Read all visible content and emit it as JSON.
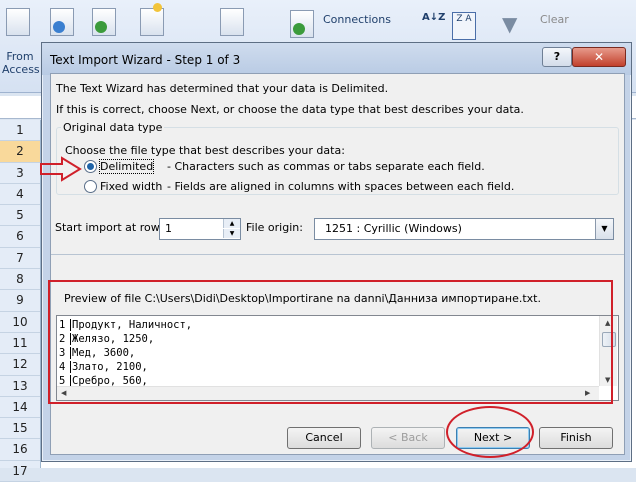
{
  "ribbon": {
    "from_access_line1": "From",
    "from_access_line2": "Access",
    "connections_label": "Connections",
    "clear_label": "Clear",
    "row_headers": [
      "1",
      "2",
      "3",
      "4",
      "5",
      "6",
      "7",
      "8",
      "9",
      "10",
      "11",
      "12",
      "13",
      "14",
      "15",
      "16",
      "17"
    ]
  },
  "dialog": {
    "title": "Text Import Wizard - Step 1 of 3",
    "help_label": "?",
    "close_label": "✕",
    "intro_line1": "The Text Wizard has determined that your data is Delimited.",
    "intro_line2": "If this is correct, choose Next, or choose the data type that best describes your data.",
    "group_label": "Original data type",
    "choose_label": "Choose the file type that best describes your data:",
    "options": [
      {
        "label": "Delimited",
        "desc": "- Characters such as commas or tabs separate each field.",
        "selected": true
      },
      {
        "label": "Fixed width",
        "desc": "- Fields are aligned in columns with spaces between each field.",
        "selected": false
      }
    ],
    "start_row_label": "Start import at row:",
    "start_row_value": "1",
    "file_origin_label": "File origin:",
    "file_origin_value": "1251 : Cyrillic (Windows)",
    "preview_label": "Preview of file C:\\Users\\Didi\\Desktop\\Importirane na danni\\Данниза импортиране.txt.",
    "preview_lines": [
      {
        "num": "1",
        "text": "Продукт, Наличност,"
      },
      {
        "num": "2",
        "text": "Желязо,  1250,"
      },
      {
        "num": "3",
        "text": "Мед, 3600,"
      },
      {
        "num": "4",
        "text": "Злато, 2100,"
      },
      {
        "num": "5",
        "text": "Сребро, 560,"
      }
    ],
    "buttons": {
      "cancel": "Cancel",
      "back": "< Back",
      "next": "Next >",
      "finish": "Finish"
    }
  },
  "colors": {
    "annotation_red": "#d0202a",
    "selected_row": "#f9d99b"
  }
}
